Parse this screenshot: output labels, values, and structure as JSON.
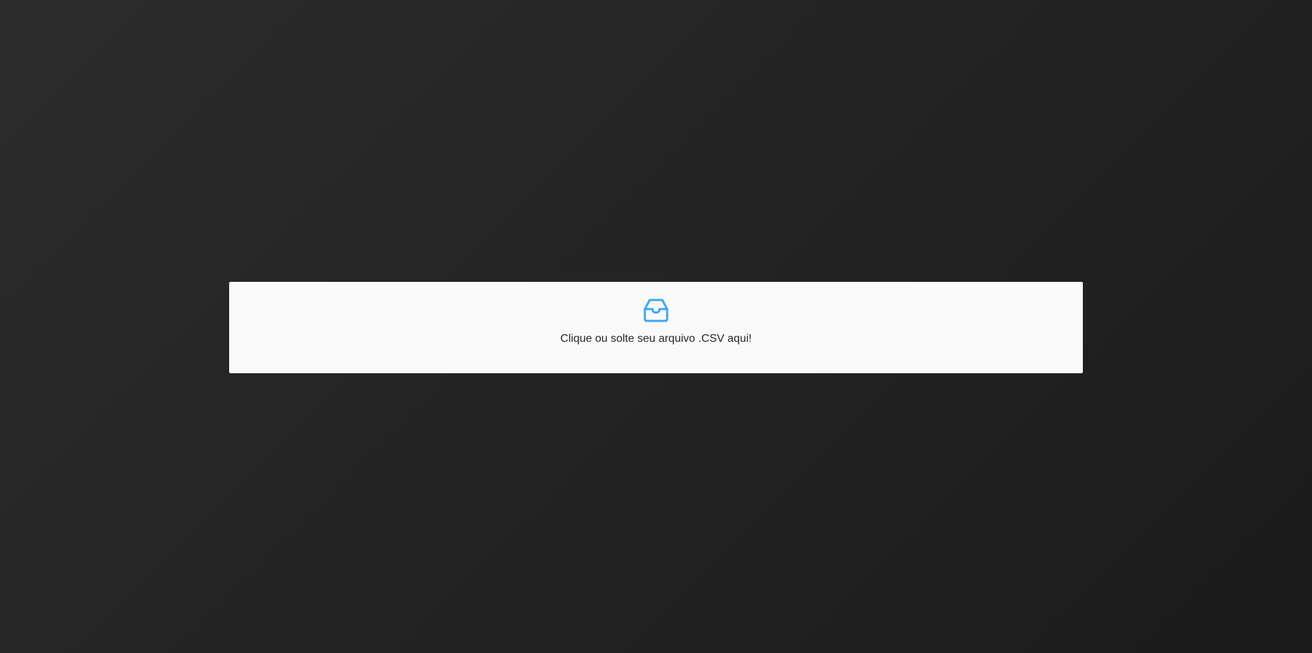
{
  "upload": {
    "icon": "inbox-icon",
    "label": "Clique ou solte seu arquivo .CSV aqui!",
    "accent_color": "#3ea6f2",
    "panel_color": "#fafafa"
  },
  "page": {
    "background_color": "#262626"
  }
}
